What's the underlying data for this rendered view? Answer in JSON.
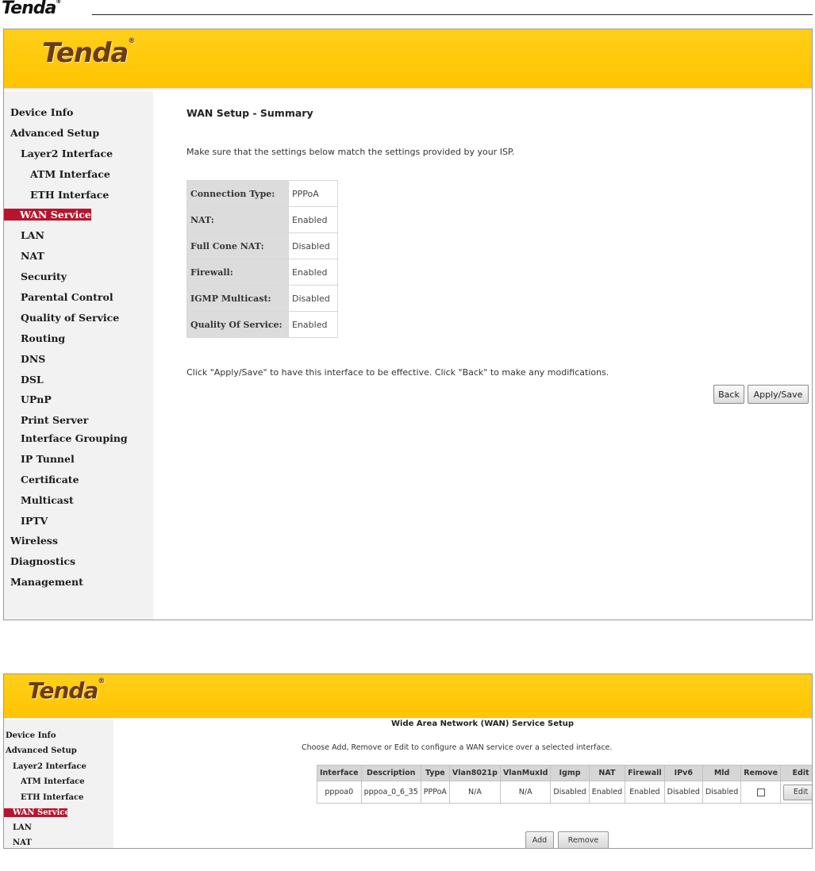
{
  "doc_header": {
    "logo": "Tenda",
    "logo_mark": "®"
  },
  "brand": {
    "name": "Tenda",
    "mark": "®"
  },
  "nav": {
    "device_info": "Device Info",
    "advanced_setup": "Advanced Setup",
    "layer2_interface": "Layer2 Interface",
    "atm_interface": "ATM Interface",
    "eth_interface": "ETH Interface",
    "wan_service": "WAN Service",
    "lan": "LAN",
    "nat": "NAT",
    "security": "Security",
    "parental_control": "Parental Control",
    "qos": "Quality of Service",
    "routing": "Routing",
    "dns": "DNS",
    "dsl": "DSL",
    "upnp": "UPnP",
    "print_server": "Print Server",
    "interface_grouping": "Interface Grouping",
    "ip_tunnel": "IP Tunnel",
    "certificate": "Certificate",
    "multicast": "Multicast",
    "iptv": "IPTV",
    "wireless": "Wireless",
    "diagnostics": "Diagnostics",
    "management": "Management"
  },
  "summary": {
    "title": "WAN Setup - Summary",
    "intro": "Make sure that the settings below match the settings provided by your ISP.",
    "rows": [
      {
        "label": "Connection Type:",
        "value": "PPPoA"
      },
      {
        "label": "NAT:",
        "value": "Enabled"
      },
      {
        "label": "Full Cone NAT:",
        "value": "Disabled"
      },
      {
        "label": "Firewall:",
        "value": "Enabled"
      },
      {
        "label": "IGMP Multicast:",
        "value": "Disabled"
      },
      {
        "label": "Quality Of Service:",
        "value": "Enabled"
      }
    ],
    "note": "Click \"Apply/Save\" to have this interface to be effective. Click \"Back\" to make any modifications.",
    "back_label": "Back",
    "apply_label": "Apply/Save"
  },
  "wan_setup": {
    "title": "Wide Area Network (WAN) Service Setup",
    "intro": "Choose Add, Remove or Edit to configure a WAN service over a selected interface.",
    "headers": [
      "Interface",
      "Description",
      "Type",
      "Vlan8021p",
      "VlanMuxId",
      "Igmp",
      "NAT",
      "Firewall",
      "IPv6",
      "Mld",
      "Remove",
      "Edit"
    ],
    "row": {
      "interface": "pppoa0",
      "description": "pppoa_0_6_35",
      "type": "PPPoA",
      "vlan8021p": "N/A",
      "vlanmuxid": "N/A",
      "igmp": "Disabled",
      "nat": "Enabled",
      "firewall": "Enabled",
      "ipv6": "Disabled",
      "mld": "Disabled",
      "remove_checked": false,
      "edit_label": "Edit"
    },
    "add_label": "Add",
    "remove_label": "Remove"
  },
  "colors": {
    "banner": "#ffc400",
    "brand_text": "#6b3b17",
    "selected_nav": "#b7152f",
    "sidebar_bg": "#f2f2f2",
    "table_header": "#d6d6d6"
  }
}
